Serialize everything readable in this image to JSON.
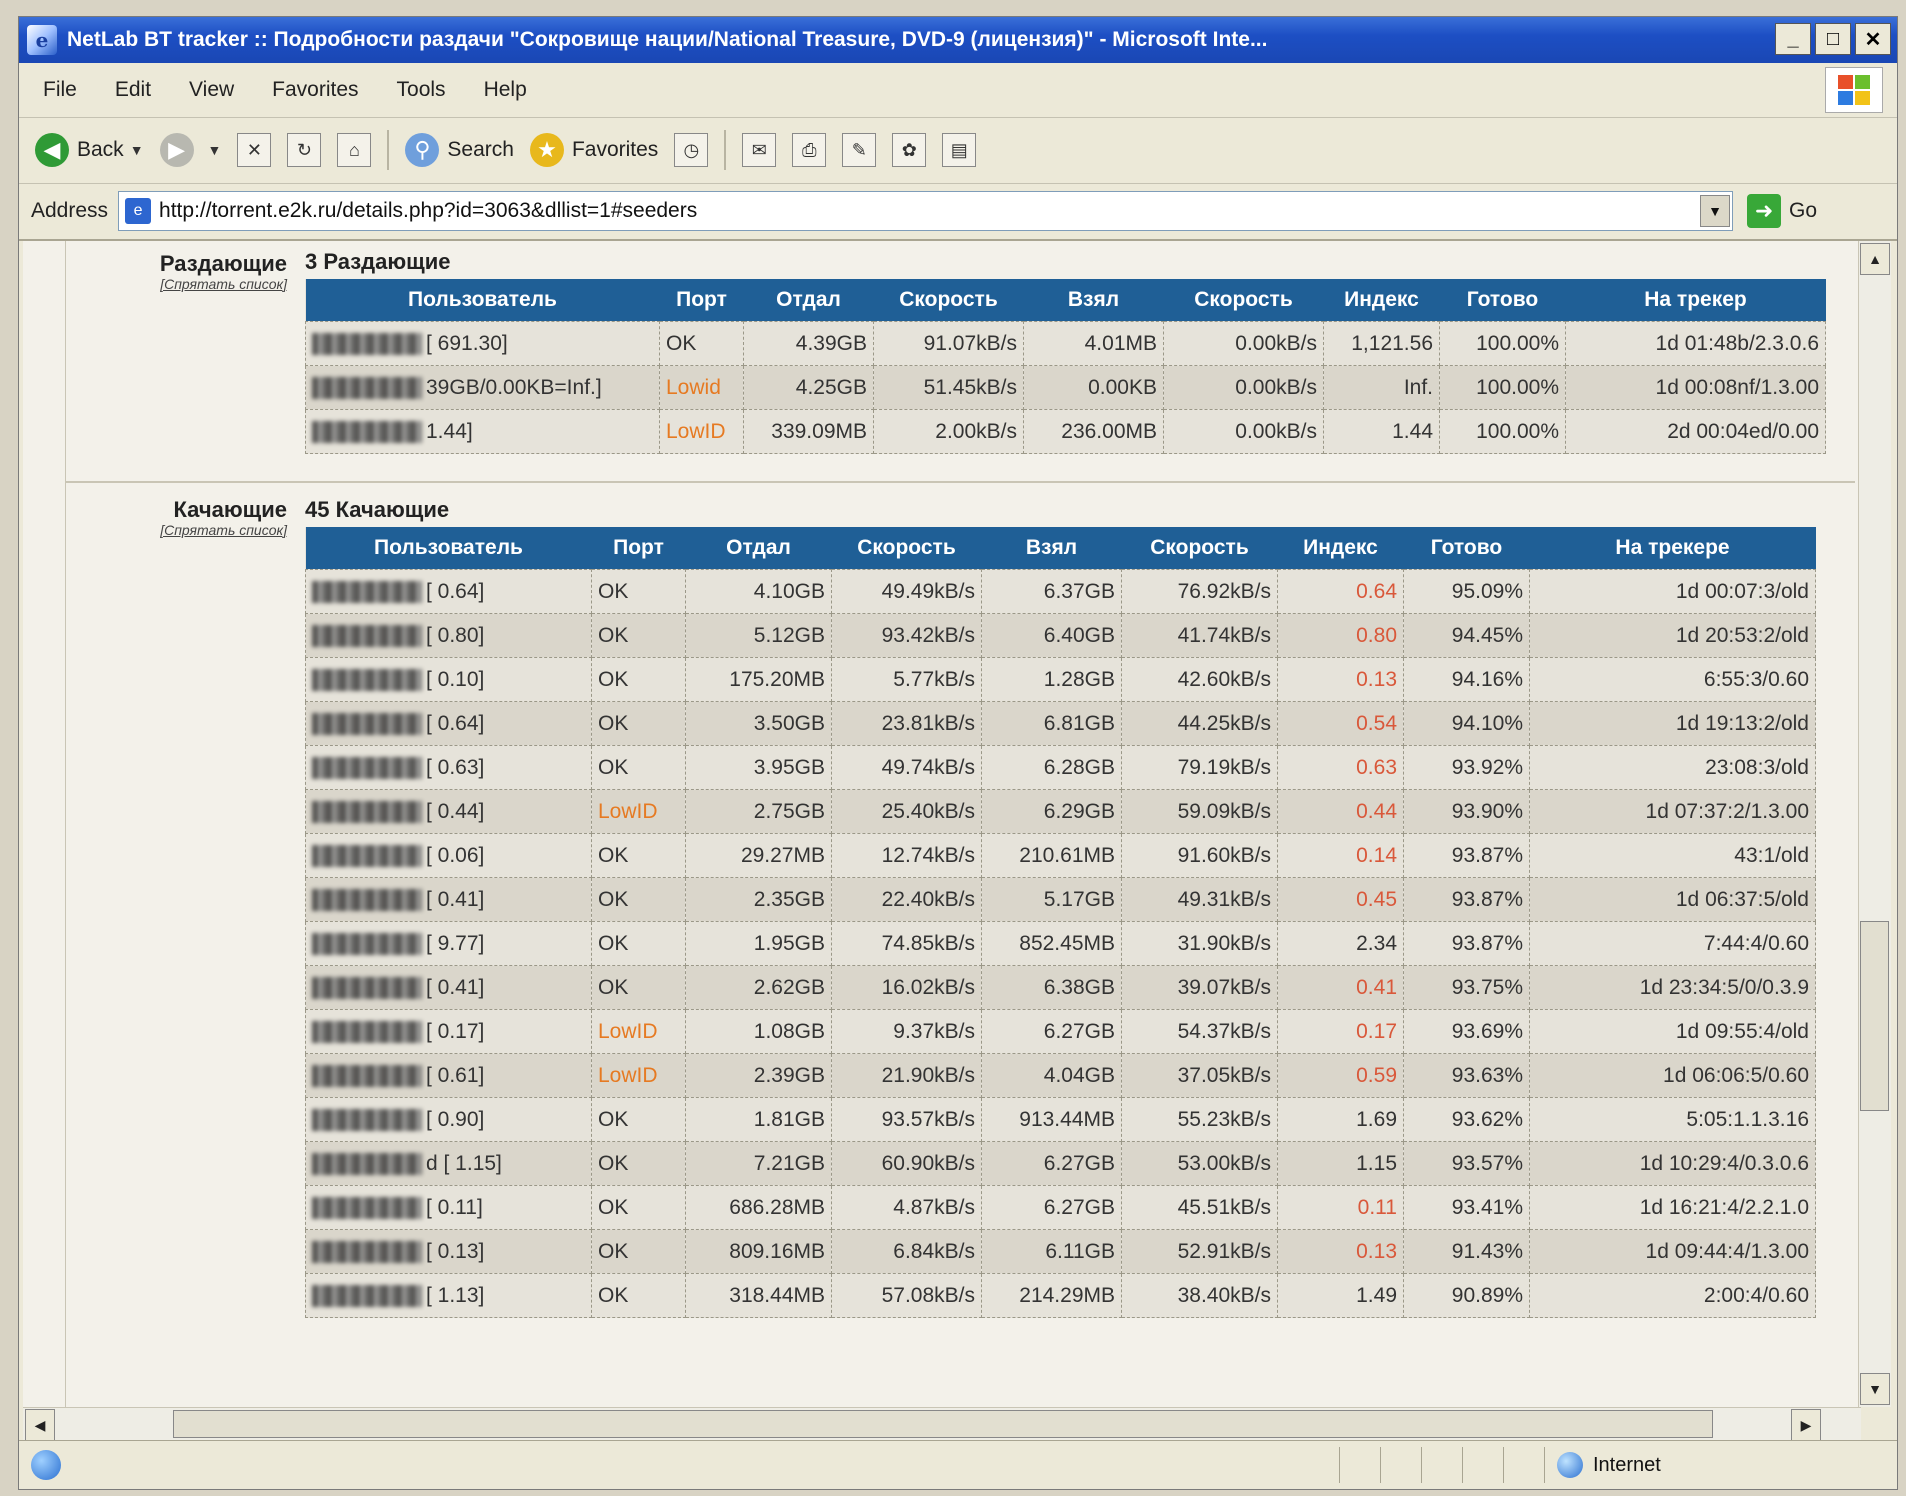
{
  "window": {
    "title": "NetLab BT tracker :: Подробности раздачи \"Сокровище нации/National Treasure, DVD-9 (лицензия)\" - Microsoft Inte...",
    "controls": [
      "_",
      "□",
      "✕"
    ]
  },
  "menu": [
    "File",
    "Edit",
    "View",
    "Favorites",
    "Tools",
    "Help"
  ],
  "toolbar": {
    "back": "Back",
    "search": "Search",
    "favorites": "Favorites"
  },
  "address": {
    "label": "Address",
    "url": "http://torrent.e2k.ru/details.php?id=3063&dllist=1#seeders",
    "go": "Go"
  },
  "seeders": {
    "label": "Раздающие",
    "sub": "[Спрятать список]",
    "count": "3 Раздающие",
    "headers": [
      "Пользователь",
      "Порт",
      "Отдал",
      "Скорость",
      "Взял",
      "Скорость",
      "Индекс",
      "Готово",
      "На трекер"
    ],
    "rows": [
      {
        "user": "[ 691.30]",
        "port": "OK",
        "up": "4.39GB",
        "ups": "91.07kB/s",
        "down": "4.01MB",
        "downs": "0.00kB/s",
        "ratio": "1,121.56",
        "done": "100.00%",
        "time": "1d 01:48b/2.3.0.6"
      },
      {
        "user": "39GB/0.00KB=Inf.]",
        "port": "Lowid",
        "up": "4.25GB",
        "ups": "51.45kB/s",
        "down": "0.00KB",
        "downs": "0.00kB/s",
        "ratio": "Inf.",
        "done": "100.00%",
        "time": "1d 00:08nf/1.3.00"
      },
      {
        "user": "1.44]",
        "port": "LowID",
        "up": "339.09MB",
        "ups": "2.00kB/s",
        "down": "236.00MB",
        "downs": "0.00kB/s",
        "ratio": "1.44",
        "done": "100.00%",
        "time": "2d 00:04ed/0.00"
      }
    ]
  },
  "leechers": {
    "label": "Качающие",
    "sub": "[Спрятать список]",
    "count": "45 Качающие",
    "headers": [
      "Пользователь",
      "Порт",
      "Отдал",
      "Скорость",
      "Взял",
      "Скорость",
      "Индекс",
      "Готово",
      "На трекере"
    ],
    "rows": [
      {
        "user": "[ 0.64]",
        "port": "OK",
        "up": "4.10GB",
        "ups": "49.49kB/s",
        "down": "6.37GB",
        "downs": "76.92kB/s",
        "ratio": "0.64",
        "done": "95.09%",
        "time": "1d 00:07:3/old"
      },
      {
        "user": "[ 0.80]",
        "port": "OK",
        "up": "5.12GB",
        "ups": "93.42kB/s",
        "down": "6.40GB",
        "downs": "41.74kB/s",
        "ratio": "0.80",
        "done": "94.45%",
        "time": "1d 20:53:2/old"
      },
      {
        "user": "[ 0.10]",
        "port": "OK",
        "up": "175.20MB",
        "ups": "5.77kB/s",
        "down": "1.28GB",
        "downs": "42.60kB/s",
        "ratio": "0.13",
        "done": "94.16%",
        "time": "6:55:3/0.60"
      },
      {
        "user": "[ 0.64]",
        "port": "OK",
        "up": "3.50GB",
        "ups": "23.81kB/s",
        "down": "6.81GB",
        "downs": "44.25kB/s",
        "ratio": "0.54",
        "done": "94.10%",
        "time": "1d 19:13:2/old"
      },
      {
        "user": "[ 0.63]",
        "port": "OK",
        "up": "3.95GB",
        "ups": "49.74kB/s",
        "down": "6.28GB",
        "downs": "79.19kB/s",
        "ratio": "0.63",
        "done": "93.92%",
        "time": "23:08:3/old"
      },
      {
        "user": "[ 0.44]",
        "port": "LowID",
        "up": "2.75GB",
        "ups": "25.40kB/s",
        "down": "6.29GB",
        "downs": "59.09kB/s",
        "ratio": "0.44",
        "done": "93.90%",
        "time": "1d 07:37:2/1.3.00"
      },
      {
        "user": "[ 0.06]",
        "port": "OK",
        "up": "29.27MB",
        "ups": "12.74kB/s",
        "down": "210.61MB",
        "downs": "91.60kB/s",
        "ratio": "0.14",
        "done": "93.87%",
        "time": "43:1/old"
      },
      {
        "user": "[ 0.41]",
        "port": "OK",
        "up": "2.35GB",
        "ups": "22.40kB/s",
        "down": "5.17GB",
        "downs": "49.31kB/s",
        "ratio": "0.45",
        "done": "93.87%",
        "time": "1d 06:37:5/old"
      },
      {
        "user": "[ 9.77]",
        "port": "OK",
        "up": "1.95GB",
        "ups": "74.85kB/s",
        "down": "852.45MB",
        "downs": "31.90kB/s",
        "ratio": "2.34",
        "done": "93.87%",
        "time": "7:44:4/0.60"
      },
      {
        "user": "[ 0.41]",
        "port": "OK",
        "up": "2.62GB",
        "ups": "16.02kB/s",
        "down": "6.38GB",
        "downs": "39.07kB/s",
        "ratio": "0.41",
        "done": "93.75%",
        "time": "1d 23:34:5/0/0.3.9"
      },
      {
        "user": "[ 0.17]",
        "port": "LowID",
        "up": "1.08GB",
        "ups": "9.37kB/s",
        "down": "6.27GB",
        "downs": "54.37kB/s",
        "ratio": "0.17",
        "done": "93.69%",
        "time": "1d 09:55:4/old"
      },
      {
        "user": "[ 0.61]",
        "port": "LowID",
        "up": "2.39GB",
        "ups": "21.90kB/s",
        "down": "4.04GB",
        "downs": "37.05kB/s",
        "ratio": "0.59",
        "done": "93.63%",
        "time": "1d 06:06:5/0.60"
      },
      {
        "user": "[ 0.90]",
        "port": "OK",
        "up": "1.81GB",
        "ups": "93.57kB/s",
        "down": "913.44MB",
        "downs": "55.23kB/s",
        "ratio": "1.69",
        "done": "93.62%",
        "time": "5:05:1.1.3.16"
      },
      {
        "user": "d [ 1.15]",
        "port": "OK",
        "up": "7.21GB",
        "ups": "60.90kB/s",
        "down": "6.27GB",
        "downs": "53.00kB/s",
        "ratio": "1.15",
        "done": "93.57%",
        "time": "1d 10:29:4/0.3.0.6"
      },
      {
        "user": "[ 0.11]",
        "port": "OK",
        "up": "686.28MB",
        "ups": "4.87kB/s",
        "down": "6.27GB",
        "downs": "45.51kB/s",
        "ratio": "0.11",
        "done": "93.41%",
        "time": "1d 16:21:4/2.2.1.0"
      },
      {
        "user": "[ 0.13]",
        "port": "OK",
        "up": "809.16MB",
        "ups": "6.84kB/s",
        "down": "6.11GB",
        "downs": "52.91kB/s",
        "ratio": "0.13",
        "done": "91.43%",
        "time": "1d 09:44:4/1.3.00"
      },
      {
        "user": "[ 1.13]",
        "port": "OK",
        "up": "318.44MB",
        "ups": "57.08kB/s",
        "down": "214.29MB",
        "downs": "38.40kB/s",
        "ratio": "1.49",
        "done": "90.89%",
        "time": "2:00:4/0.60"
      }
    ]
  },
  "status": {
    "zone": "Internet"
  }
}
